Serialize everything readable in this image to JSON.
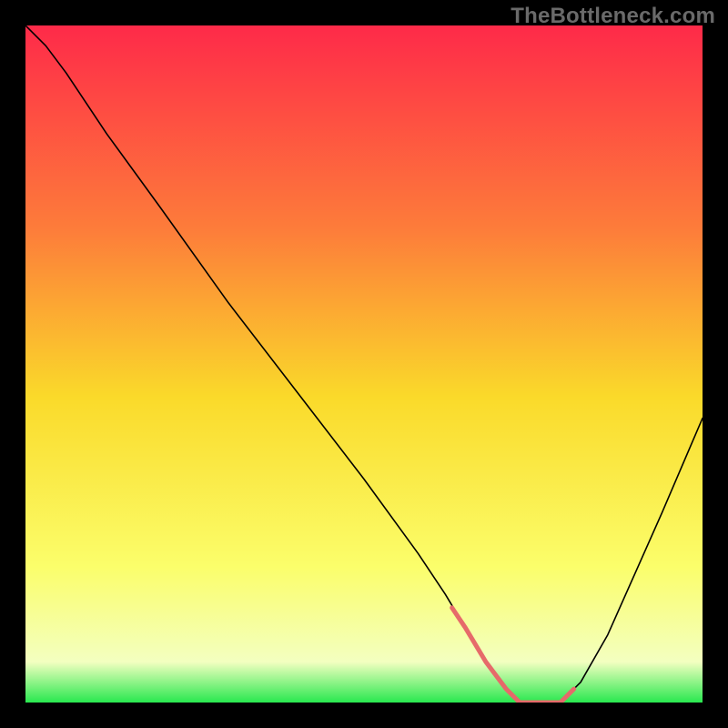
{
  "watermark": "TheBottleneck.com",
  "chart_data": {
    "type": "line",
    "title": "",
    "xlabel": "",
    "ylabel": "",
    "xlim": [
      0,
      100
    ],
    "ylim": [
      0,
      100
    ],
    "grid": false,
    "legend": false,
    "background": {
      "gradient_stops": [
        {
          "offset": 0,
          "color": "#fe2a49"
        },
        {
          "offset": 30,
          "color": "#fd7c3a"
        },
        {
          "offset": 55,
          "color": "#fada2a"
        },
        {
          "offset": 80,
          "color": "#fbfe6b"
        },
        {
          "offset": 94,
          "color": "#f3ffc0"
        },
        {
          "offset": 100,
          "color": "#29e84f"
        }
      ]
    },
    "series": [
      {
        "name": "curve",
        "color": "#000000",
        "width": 1.6,
        "x": [
          0,
          3,
          6,
          12,
          20,
          30,
          40,
          50,
          58,
          62,
          65,
          68,
          71,
          73,
          76,
          79,
          82,
          86,
          90,
          94,
          100
        ],
        "y": [
          100,
          97,
          93,
          84,
          73,
          59,
          46,
          33,
          22,
          16,
          11,
          6,
          2,
          0,
          0,
          0,
          3,
          10,
          19,
          28,
          42
        ]
      },
      {
        "name": "trough-highlight",
        "color": "#e66a6a",
        "width": 5,
        "x": [
          63,
          65,
          68,
          71,
          73,
          76,
          79,
          81
        ],
        "y": [
          14,
          11,
          6,
          2,
          0,
          0,
          0,
          2
        ]
      }
    ]
  }
}
